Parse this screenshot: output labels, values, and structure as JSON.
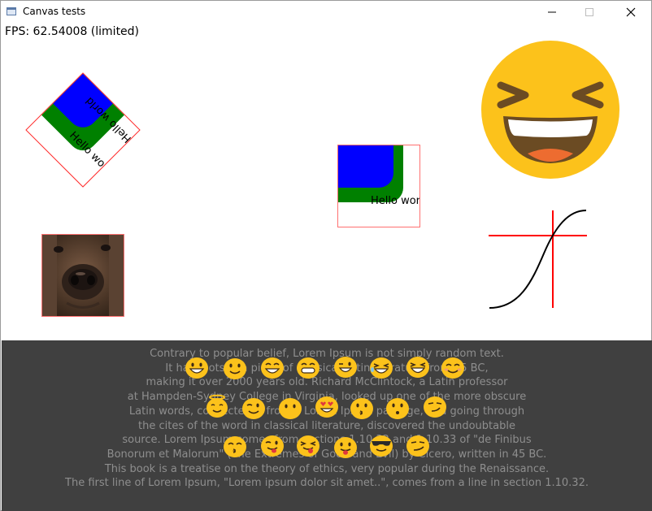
{
  "window": {
    "title": "Canvas tests"
  },
  "fps_text": "FPS: 62.54008 (limited)",
  "canvas": {
    "rotated_label": "Hello world",
    "plain_label": "Hello world",
    "image_alt": "dog photo",
    "big_emoji": "laughing-squinting-face",
    "curve": "sigmoid-curve"
  },
  "paragraph": [
    "Contrary to popular belief, Lorem Ipsum is not simply random text.",
    "It has roots in a piece of classical Latin literature from 45 BC,",
    "making it over 2000 years old. Richard McClintock, a Latin professor",
    "at Hampden-Sydney College in Virginia, looked up one of the more obscure",
    "Latin words, consectetur, from a Lorem Ipsum passage, and going through",
    "the cites of the word in classical literature, discovered the undoubtable",
    "source. Lorem Ipsum comes from sections 1.10.32 and 1.10.33 of \"de Finibus",
    "Bonorum et Malorum\" (The Extremes of Good and Evil) by Cicero, written in 45 BC.",
    "This book is a treatise on the theory of ethics, very popular during the Renaissance.",
    "The first line of Lorem Ipsum, \"Lorem ipsum dolor sit amet..\", comes from a line in section 1.10.32."
  ],
  "emoji_rows": [
    [
      "grinning",
      "smiling",
      "grin-sweat",
      "beaming",
      "wink-grin",
      "laughing-tear",
      "laughing",
      "smiling-closed-eyes"
    ],
    [
      "halo",
      "wink",
      "neutral",
      "heart-eyes",
      "kissing",
      "blush-kiss",
      "smirk"
    ],
    [
      "kiss-closed-eyes",
      "tongue-wink",
      "tongue-out",
      "tongue",
      "sunglasses",
      "smirk"
    ]
  ],
  "colors": {
    "panel_bg": "#404040",
    "panel_text": "#8e8e8e",
    "emoji_yellow": "#fcc21b",
    "blue": "#0000ff",
    "green": "#008000",
    "red_border": "#ff2a2a"
  }
}
